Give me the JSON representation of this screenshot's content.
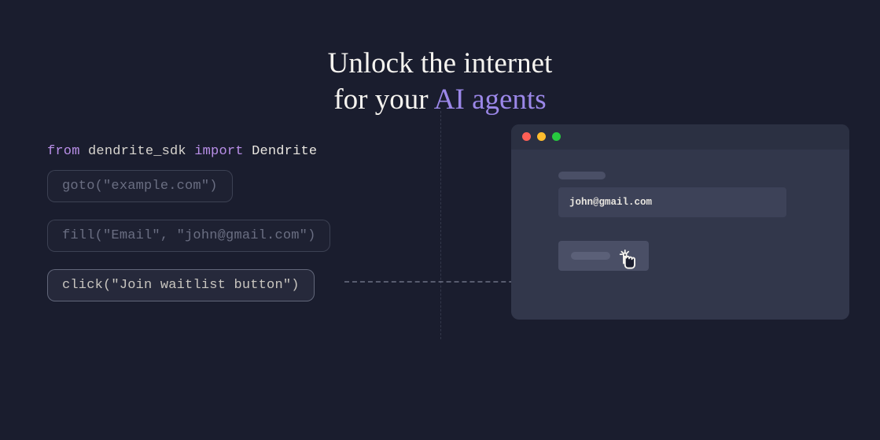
{
  "hero": {
    "line1": "Unlock the internet",
    "line2_prefix": "for your ",
    "line2_accent": "AI agents"
  },
  "code": {
    "import": {
      "from": "from",
      "module": "dendrite_sdk",
      "import_kw": "import",
      "class_name": "Dendrite"
    },
    "lines": [
      {
        "fn": "goto",
        "args": "\"example.com\"",
        "active": false
      },
      {
        "fn": "fill",
        "args": "\"Email\", \"john@gmail.com\"",
        "active": false
      },
      {
        "fn": "click",
        "args": "\"Join waitlist button\"",
        "active": true
      }
    ]
  },
  "browser": {
    "email_value": "john@gmail.com"
  },
  "colors": {
    "background": "#1a1d2e",
    "accent_purple": "#9b87e8",
    "text_light": "#f5f3ef"
  }
}
